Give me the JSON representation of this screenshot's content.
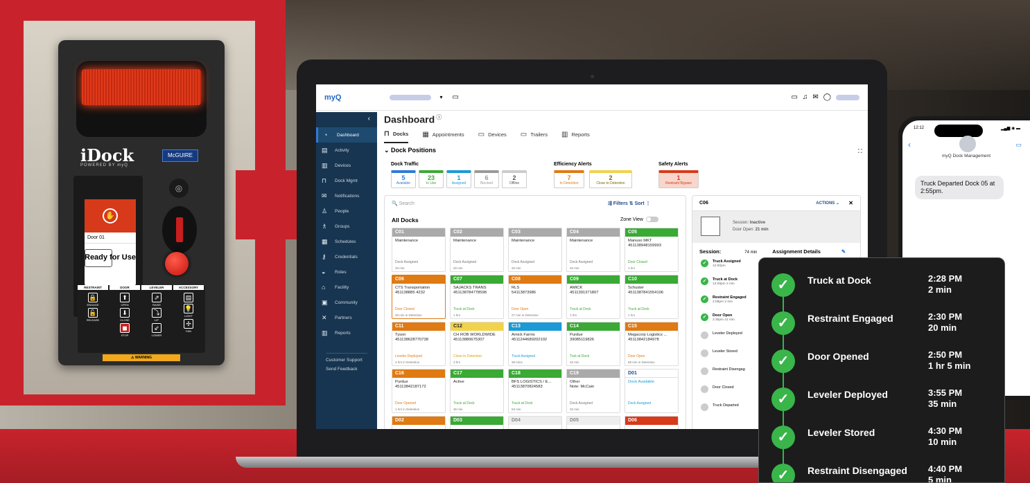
{
  "device": {
    "brand": "iDock",
    "brand_sub": "POWERED BY myQ",
    "maker": "McGUIRE",
    "screen_door": "Door 01",
    "screen_status": "Ready for Use",
    "columns": [
      {
        "h": "RESTRAINT",
        "b": [
          [
            "🔒",
            "ENGAGE"
          ],
          [
            "🔓",
            "RELEASE"
          ]
        ]
      },
      {
        "h": "DOOR",
        "b": [
          [
            "⬆",
            "OPEN"
          ],
          [
            "⬇",
            "CLOSE"
          ],
          [
            "◼",
            "STOP"
          ]
        ]
      },
      {
        "h": "LEVELER",
        "b": [
          [
            "⇗",
            "RAISE"
          ],
          [
            "⤵",
            "LIP"
          ],
          [
            "⇙",
            "LOWER"
          ]
        ]
      },
      {
        "h": "ACCESSORY",
        "b": [
          [
            "▤",
            ""
          ],
          [
            "💡",
            "LIGHT"
          ],
          [
            "✢",
            "FAN"
          ]
        ]
      }
    ],
    "warning": "⚠ WARNING"
  },
  "app": {
    "logo": "myQ",
    "title": "Dashboard",
    "tabs": [
      "Docks",
      "Appointments",
      "Devices",
      "Trailers",
      "Reports"
    ],
    "section": "Dock Positions",
    "sidebar": [
      [
        "◔",
        "Dashboard"
      ],
      [
        "▤",
        "Activity"
      ],
      [
        "▥",
        "Devices"
      ],
      [
        "⊓",
        "Dock Mgmt"
      ],
      [
        "✉",
        "Notifications"
      ],
      [
        "♙",
        "People"
      ],
      [
        "♗",
        "Groups"
      ],
      [
        "▦",
        "Schedules"
      ],
      [
        "⚷",
        "Credentials"
      ],
      [
        "◒",
        "Roles"
      ],
      [
        "⌂",
        "Facility"
      ],
      [
        "▣",
        "Community"
      ],
      [
        "✕",
        "Partners"
      ],
      [
        "▥",
        "Reports"
      ]
    ],
    "footer": [
      "Customer Support",
      "Send Feedback"
    ],
    "labels": {
      "traffic": "Dock Traffic",
      "efficiency": "Efficiency Alerts",
      "safety": "Safety Alerts"
    },
    "stats": [
      {
        "n": "5",
        "l": "Available",
        "c": "#2d7bd9"
      },
      {
        "n": "23",
        "l": "In Use",
        "c": "#3aa935"
      },
      {
        "n": "1",
        "l": "Assigned",
        "c": "#1a9ad6"
      },
      {
        "n": "6",
        "l": "Blocked",
        "c": "#999"
      },
      {
        "n": "2",
        "l": "Offline",
        "c": "#ccc"
      },
      {
        "n": "7",
        "l": "In Detention",
        "c": "#e07a12"
      },
      {
        "n": "2",
        "l": "Close to Detention",
        "c": "#f0d34a"
      },
      {
        "n": "1",
        "l": "Restraint Bypass",
        "c": "#d63a1a"
      }
    ],
    "search": "Search",
    "filters": "⇶ Filters   ⇅ Sort   ⋮",
    "all_docks": "All Docks",
    "zone_view": "Zone View",
    "docks": [
      {
        "id": "C01",
        "c": "#aaa",
        "t": "Maintenance",
        "s": "Dock Assigned",
        "m": "20 min",
        "sc": "#777"
      },
      {
        "id": "C02",
        "c": "#aaa",
        "t": "Maintenance",
        "s": "Dock Assigned",
        "m": "20 min",
        "sc": "#777"
      },
      {
        "id": "C03",
        "c": "#aaa",
        "t": "Maintenance",
        "s": "Dock Assigned",
        "m": "20 min",
        "sc": "#777"
      },
      {
        "id": "C04",
        "c": "#aaa",
        "t": "Maintenance",
        "s": "Dock Assigned",
        "m": "20 min",
        "sc": "#777"
      },
      {
        "id": "C05",
        "c": "#3aa935",
        "t": "Manuso MKT\n451138948159993",
        "s": "Door Closed",
        "m": "1 hrs",
        "sc": "#3aa935"
      },
      {
        "id": "C06",
        "c": "#e07a12",
        "t": "CTS Transportation\n451138885 4232",
        "s": "Door Closed",
        "m": "30 min in Detention",
        "sc": "#e07a12"
      },
      {
        "id": "C07",
        "c": "#3aa935",
        "t": "SAJACKS TRANS\n451138784778598",
        "s": "Truck at Dock",
        "m": "1 hrs",
        "sc": "#3aa935"
      },
      {
        "id": "C08",
        "c": "#e07a12",
        "t": "RLS\n54113873986",
        "s": "Door Open",
        "m": "27 min in Detention",
        "sc": "#e07a12"
      },
      {
        "id": "C09",
        "c": "#3aa935",
        "t": "AMICK\n4511391371807",
        "s": "Truck at Dock",
        "m": "1 hrs",
        "sc": "#3aa935"
      },
      {
        "id": "C10",
        "c": "#3aa935",
        "t": "Schuster\n4511387841554106",
        "s": "Truck at Dock",
        "m": "1 hrs",
        "sc": "#3aa935"
      },
      {
        "id": "C11",
        "c": "#e07a12",
        "t": "Tyson\n451138628770738",
        "s": "Leveler Deployed",
        "m": "4 hrs in Detention",
        "sc": "#e07a12"
      },
      {
        "id": "C12",
        "c": "#f0d34a",
        "t": "CH ROB WORLDWIDE\n45113889675307",
        "s": "Close to Detention",
        "m": "3 hrs",
        "sc": "#d7a312"
      },
      {
        "id": "C13",
        "c": "#1a9ad6",
        "t": "Amick Farms\n4511244689202102",
        "s": "Truck Assigned",
        "m": "38 mins",
        "sc": "#1a9ad6"
      },
      {
        "id": "C14",
        "c": "#3aa935",
        "t": "Purdue\n39085119826",
        "s": "Truk at Dock",
        "m": "32 min",
        "sc": "#3aa935"
      },
      {
        "id": "C15",
        "c": "#e07a12",
        "t": "Megacorp Logistics ...\n45113842184978",
        "s": "Door Open",
        "m": "59 min in Detention",
        "sc": "#e07a12"
      },
      {
        "id": "C16",
        "c": "#e07a12",
        "t": "Purdue\n45113842187172",
        "s": "Door Opened",
        "m": "1 hrs in Detention",
        "sc": "#e07a12"
      },
      {
        "id": "C17",
        "c": "#3aa935",
        "t": "Active",
        "s": "Truck at Dock",
        "m": "36 min",
        "sc": "#3aa935"
      },
      {
        "id": "C18",
        "c": "#3aa935",
        "t": "BFS LOGISTICS / E...\n45113870824583",
        "s": "Truck at Dock",
        "m": "53 min",
        "sc": "#3aa935"
      },
      {
        "id": "C19",
        "c": "#aaa",
        "t": "Other\nNote: McCain",
        "s": "Dock Assigned",
        "m": "20 min",
        "sc": "#777"
      },
      {
        "id": "D01",
        "c": "#fff",
        "t": "Dock Available",
        "s": "Dock Assigned",
        "m": "",
        "sc": "#1a9ad6"
      }
    ],
    "last_row": [
      {
        "id": "D02",
        "c": "#e07a12"
      },
      {
        "id": "D03",
        "c": "#3aa935"
      },
      {
        "id": "D04",
        "c": "#ddd"
      },
      {
        "id": "D05",
        "c": "#ddd"
      },
      {
        "id": "D06",
        "c": "#d63a1a"
      }
    ],
    "detail": {
      "id": "C06",
      "actions": "ACTIONS ⌄",
      "session_lbl": "Session:",
      "session": "Inactive",
      "door_open_lbl": "Door Open:",
      "door_open": "21 min",
      "sess_title": "Session:",
      "sess_time": "74 min",
      "assign": "Assignment Details",
      "events": [
        {
          "t": "Truck Assigned",
          "s": "12:00pm",
          "done": true
        },
        {
          "t": "Truck at Dock",
          "s": "12:08pm 2 min",
          "done": true
        },
        {
          "t": "Restraint Engaged",
          "s": "2:08pm 2 min",
          "done": true
        },
        {
          "t": "Door Open",
          "s": "2:30pm 21 min",
          "done": true
        },
        {
          "t": "Leveler Deployed",
          "s": "",
          "done": false
        },
        {
          "t": "Leveler Stored",
          "s": "",
          "done": false
        },
        {
          "t": "Restraint Disengag",
          "s": "",
          "done": false
        },
        {
          "t": "Door Closed",
          "s": "",
          "done": false
        },
        {
          "t": "Truck Departed",
          "s": "",
          "done": false
        }
      ]
    }
  },
  "phone": {
    "time": "12:12",
    "contact": "myQ Dock Management",
    "message": "Truck Departed Dock 05 at 2:55pm."
  },
  "timeline": [
    {
      "label": "Truck at Dock",
      "time": "2:28 PM",
      "dur": "2 min"
    },
    {
      "label": "Restraint Engaged",
      "time": "2:30 PM",
      "dur": "20 min"
    },
    {
      "label": "Door Opened",
      "time": "2:50 PM",
      "dur": "1 hr 5 min"
    },
    {
      "label": "Leveler Deployed",
      "time": "3:55 PM",
      "dur": "35 min"
    },
    {
      "label": "Leveler Stored",
      "time": "4:30 PM",
      "dur": "10 min"
    },
    {
      "label": "Restraint Disengaged",
      "time": "4:40 PM",
      "dur": "5 min"
    }
  ]
}
